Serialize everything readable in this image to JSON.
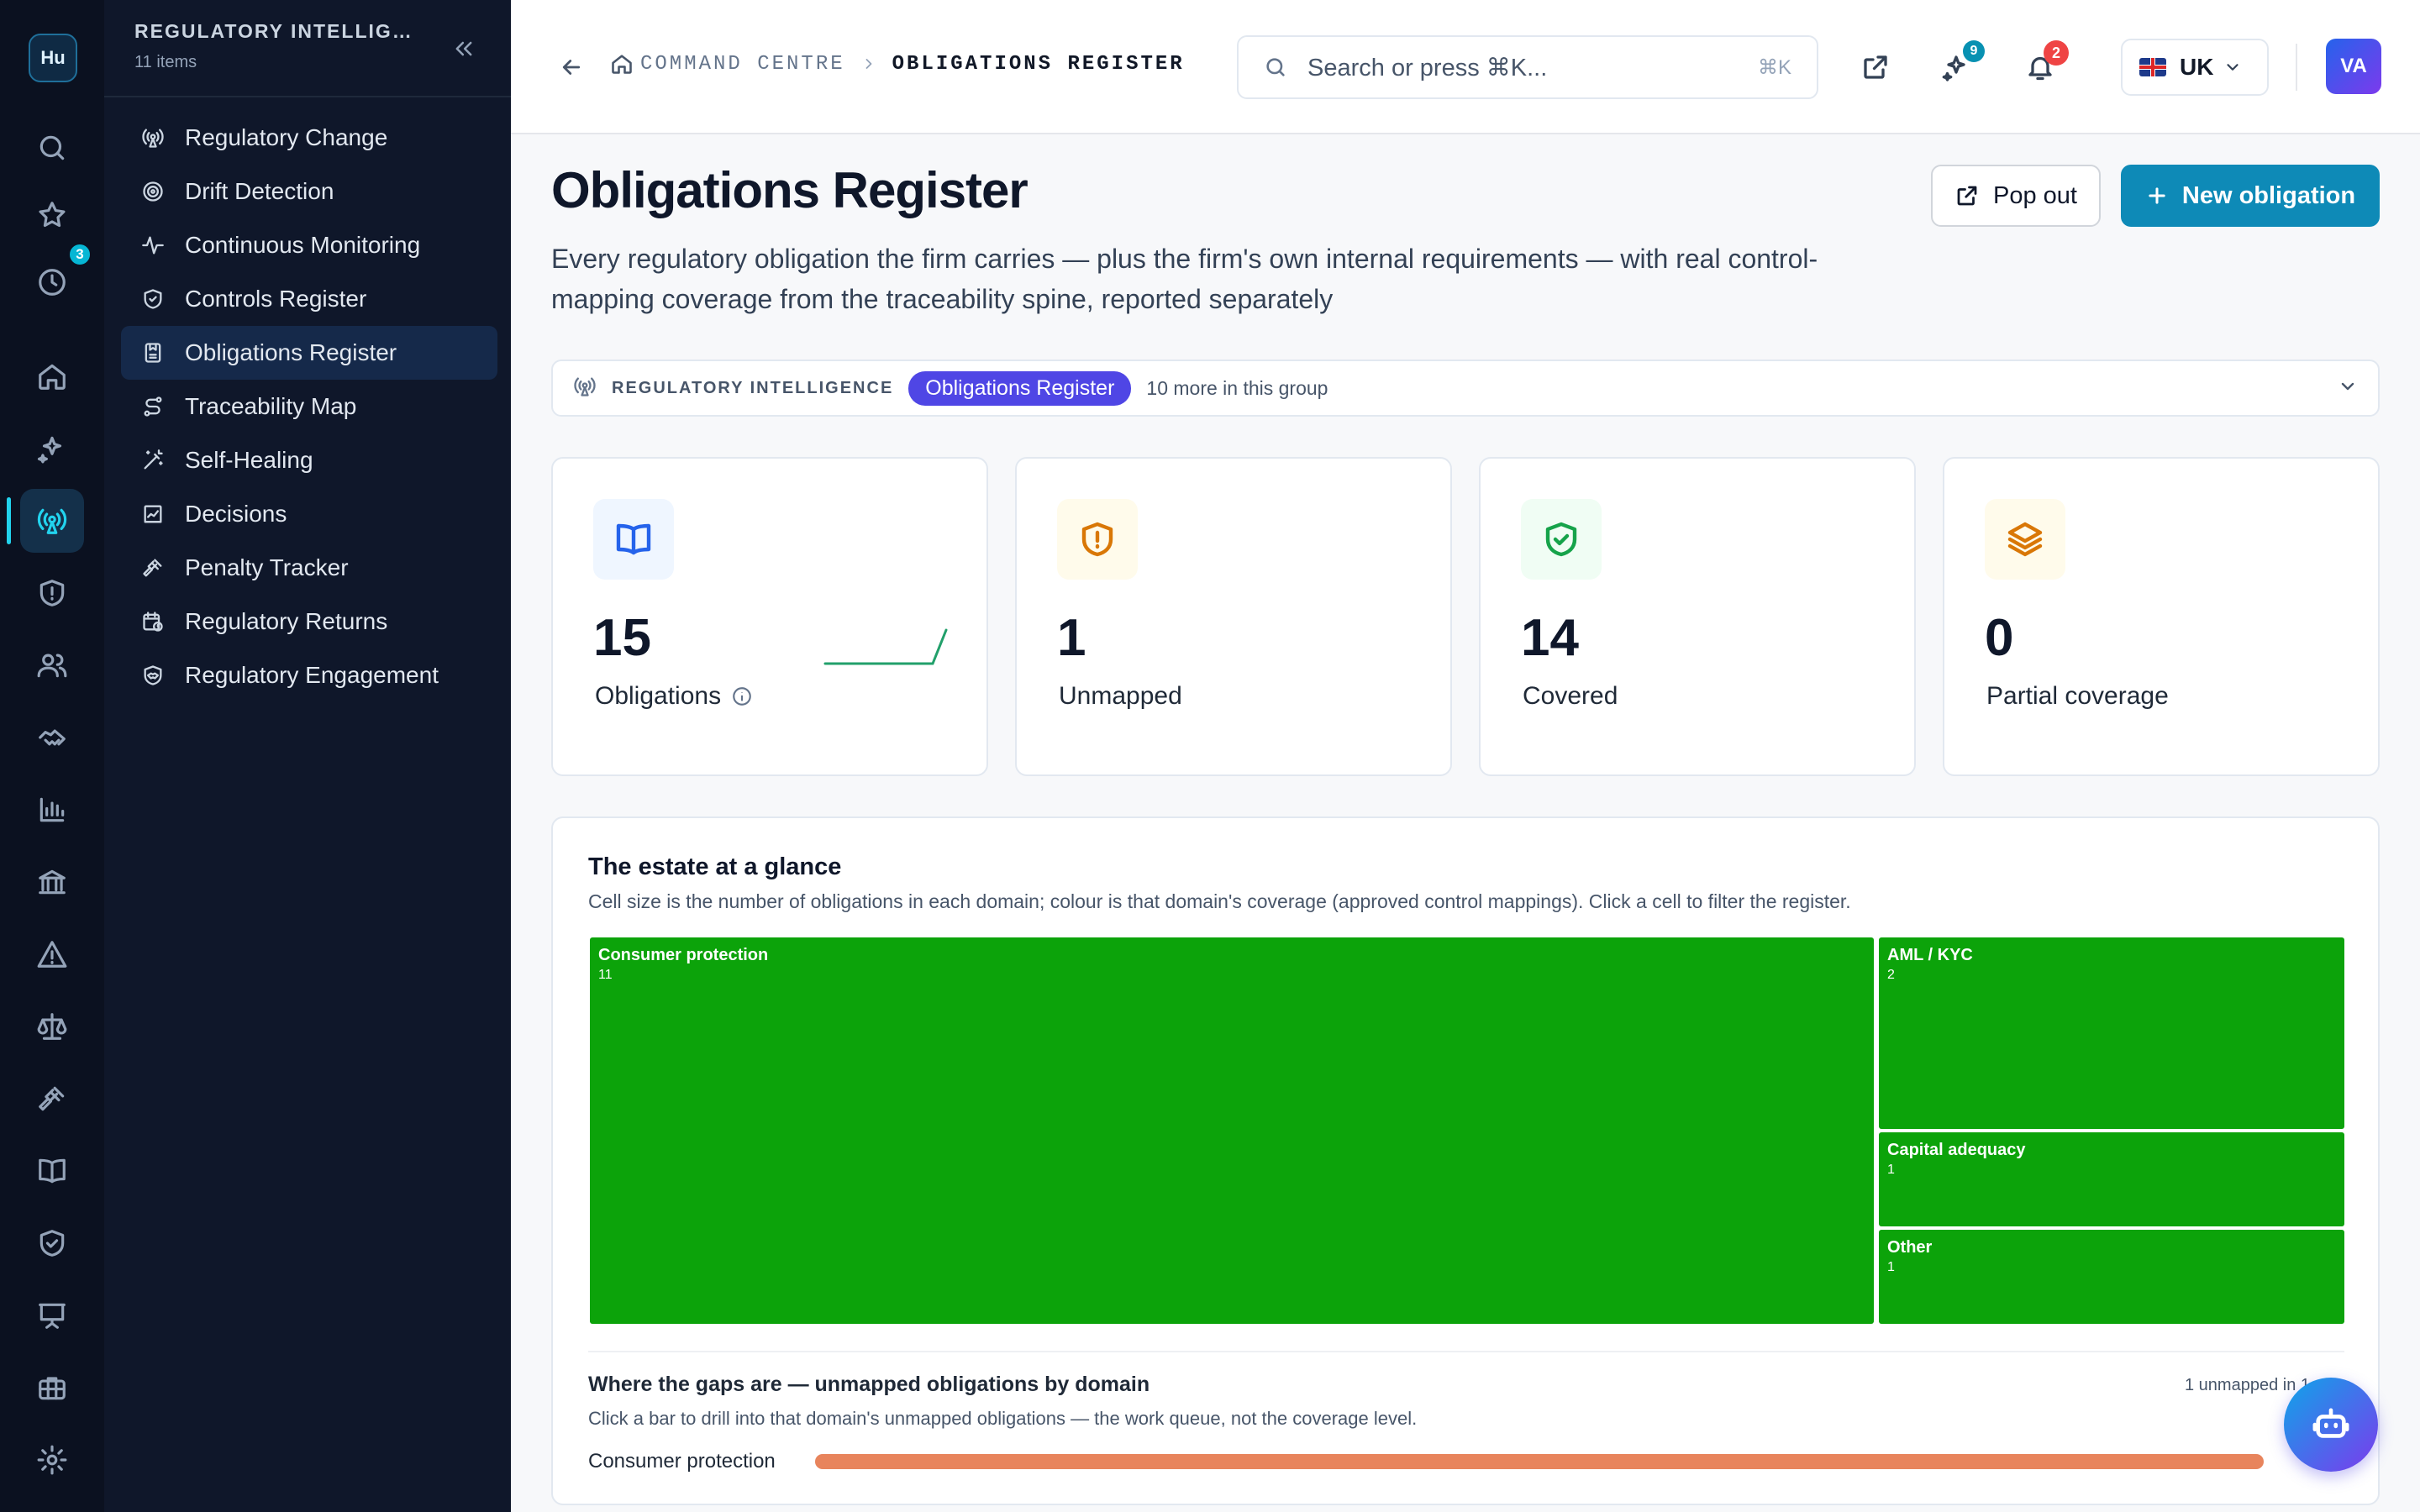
{
  "rail": {
    "logo_text": "Hu",
    "badge": "3",
    "icons": [
      "search-icon",
      "star-icon",
      "history-icon",
      "home-icon",
      "sparkles-icon",
      "broadcast-icon",
      "shield-alert-icon",
      "users-icon",
      "handshake-icon",
      "bar-chart-icon",
      "bank-icon",
      "warning-icon",
      "scale-icon",
      "gavel-icon",
      "book-icon",
      "shield-check-icon",
      "presentation-icon",
      "briefcase-icon",
      "gear-icon"
    ]
  },
  "sidebar": {
    "title": "REGULATORY INTELLIGENCE",
    "count": "11 items",
    "items": [
      {
        "label": "Regulatory Change",
        "icon": "broadcast-icon"
      },
      {
        "label": "Drift Detection",
        "icon": "target-icon"
      },
      {
        "label": "Continuous Monitoring",
        "icon": "activity-icon"
      },
      {
        "label": "Controls Register",
        "icon": "shield-icon"
      },
      {
        "label": "Obligations Register",
        "icon": "clipboard-icon"
      },
      {
        "label": "Traceability Map",
        "icon": "route-icon"
      },
      {
        "label": "Self-Healing",
        "icon": "wand-icon"
      },
      {
        "label": "Decisions",
        "icon": "chart-icon"
      },
      {
        "label": "Penalty Tracker",
        "icon": "gavel-icon"
      },
      {
        "label": "Regulatory Returns",
        "icon": "calendar-clock-icon"
      },
      {
        "label": "Regulatory Engagement",
        "icon": "handshake-shield-icon"
      }
    ]
  },
  "topbar": {
    "crumb_home": "COMMAND CENTRE",
    "crumb_current": "OBLIGATIONS REGISTER",
    "search_placeholder": "Search or press ⌘K...",
    "search_kbd": "⌘K",
    "ai_badge": "9",
    "notif_badge": "2",
    "region": "UK",
    "avatar": "VA"
  },
  "page": {
    "title": "Obligations Register",
    "description": "Every regulatory obligation the firm carries — plus the firm's own internal requirements — with real control-mapping coverage from the traceability spine, reported separately",
    "pop_out": "Pop out",
    "new_obligation": "New obligation"
  },
  "group": {
    "name": "REGULATORY INTELLIGENCE",
    "current": "Obligations Register",
    "more": "10 more in this group"
  },
  "kpis": [
    {
      "value": "15",
      "label": "Obligations",
      "icon": "book-open-icon",
      "color": "#2563eb",
      "bg": "#eff6ff"
    },
    {
      "value": "1",
      "label": "Unmapped",
      "icon": "shield-alert-icon",
      "color": "#d97706",
      "bg": "#fffbeb"
    },
    {
      "value": "14",
      "label": "Covered",
      "icon": "shield-check-icon",
      "color": "#16a34a",
      "bg": "#f0fdf4"
    },
    {
      "value": "0",
      "label": "Partial coverage",
      "icon": "layers-icon",
      "color": "#d97706",
      "bg": "#fffbeb"
    }
  ],
  "treemap": {
    "title": "The estate at a glance",
    "subtitle": "Cell size is the number of obligations in each domain; colour is that domain's coverage (approved control mappings). Click a cell to filter the register.",
    "color": "#0ca30a",
    "cells": [
      {
        "name": "Consumer protection",
        "value": 11
      },
      {
        "name": "AML / KYC",
        "value": 2
      },
      {
        "name": "Capital adequacy",
        "value": 1
      },
      {
        "name": "Other",
        "value": 1
      }
    ]
  },
  "gaps": {
    "title": "Where the gaps are — unmapped obligations by domain",
    "subtitle": "Click a bar to drill into that domain's unmapped obligations — the work queue, not the coverage level.",
    "meta": "1 unmapped in 1 domain",
    "rows": [
      {
        "label": "Consumer protection",
        "value": 1,
        "max": 1
      }
    ]
  }
}
